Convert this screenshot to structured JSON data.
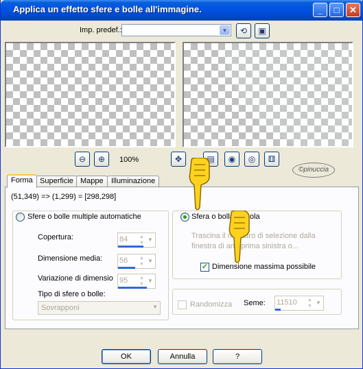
{
  "window": {
    "title": "Applica un effetto sfere e bolle all'immagine.",
    "controls": {
      "minimize": "_",
      "maximize": "□",
      "close": "✕"
    }
  },
  "preset": {
    "label": "Imp. predef.:",
    "value": ""
  },
  "zoom": {
    "level": "100%"
  },
  "watermark": "©pinuccia",
  "tabs": [
    "Forma",
    "Superficie",
    "Mappe",
    "Illuminazione"
  ],
  "coords": "(51,349) => (1,299) = [298,298]",
  "left_group": {
    "radio_label": "Sfere o bolle multiple automatiche",
    "fields": [
      {
        "label": "Copertura:",
        "value": "84",
        "fill": 0.84
      },
      {
        "label": "Dimensione media:",
        "value": "56",
        "fill": 0.56
      },
      {
        "label": "Variazione di dimensio",
        "value": "95",
        "fill": 0.95
      }
    ],
    "type_label": "Tipo di sfere o bolle:",
    "type_value": "Sovrapponi"
  },
  "right_group": {
    "radio_label": "Sfera o bolla singola",
    "hint": "Trascina il riquadro di selezione dalla finestra di anteprima sinistra o...",
    "checkbox_label": "Dimensione massima possibile",
    "checkbox_checked": true
  },
  "random": {
    "checkbox_label": "Randomizza",
    "seed_label": "Seme:",
    "seed_value": "11510"
  },
  "footer": {
    "ok": "OK",
    "cancel": "Annulla",
    "help": "?"
  },
  "colors": {
    "accent": "#0054e3",
    "hand": "#ffd21f"
  }
}
